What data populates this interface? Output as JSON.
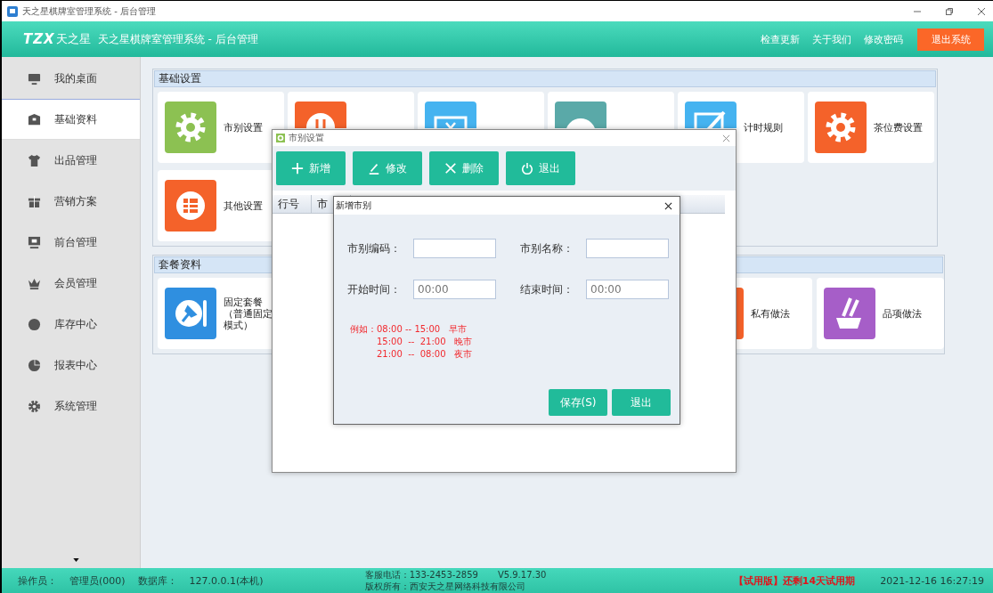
{
  "window": {
    "title": "天之星棋牌室管理系统 - 后台管理"
  },
  "header": {
    "logo_mark": "TZX",
    "logo_text": "天之星",
    "title": "天之星棋牌室管理系统 - 后台管理",
    "links": [
      "检查更新",
      "关于我们",
      "修改密码"
    ],
    "exit_button": "退出系统"
  },
  "sidebar": {
    "items": [
      {
        "label": "我的桌面",
        "selected": false
      },
      {
        "label": "基础资料",
        "selected": true
      },
      {
        "label": "出品管理",
        "selected": false
      },
      {
        "label": "营销方案",
        "selected": false
      },
      {
        "label": "前台管理",
        "selected": false
      },
      {
        "label": "会员管理",
        "selected": false
      },
      {
        "label": "库存中心",
        "selected": false
      },
      {
        "label": "报表中心",
        "selected": false
      },
      {
        "label": "系统管理",
        "selected": false
      }
    ]
  },
  "groups": [
    {
      "title": "基础设置",
      "tiles": [
        {
          "label": [
            "市别设置"
          ],
          "color": "#8cc152"
        },
        {
          "color": "#f4622a"
        },
        {
          "color": "#45b3f0"
        },
        {
          "color": "#5aa9a8"
        },
        {
          "label": [
            "计时规则"
          ],
          "color": "#45b3f0"
        },
        {
          "label": [
            "茶位费设置"
          ],
          "color": "#f4622a"
        },
        {
          "label": [
            "其他设置"
          ],
          "color": "#f4622a"
        }
      ]
    },
    {
      "title": "套餐资料",
      "tiles": [
        {
          "label": [
            "固定套餐",
            "（普通固定",
            "模式）"
          ],
          "color": "#2f8fe0"
        },
        {
          "label": [
            "私有做法"
          ],
          "color": "#f4622a"
        },
        {
          "label": [
            "品项做法"
          ],
          "color": "#a65ec8"
        }
      ]
    }
  ],
  "settings_dialog": {
    "title": "市别设置",
    "buttons": [
      "新增",
      "修改",
      "删除",
      "退出"
    ],
    "columns": [
      "行号",
      "市"
    ]
  },
  "add_dialog": {
    "title": "新增市别",
    "fields": [
      {
        "label": "市别编码："
      },
      {
        "label": "市别名称："
      },
      {
        "label": "开始时间：",
        "value": "00:00"
      },
      {
        "label": "结束时间：",
        "value": "00:00"
      }
    ],
    "example_lines": [
      "例如：08:00 -- 15:00   早市",
      "15:00  --  21:00   晚市",
      "21:00  --  08:00   夜市"
    ],
    "buttons": [
      "保存(S)",
      "退出"
    ]
  },
  "status_bar": {
    "operator_label": "操作员：",
    "operator": "管理员(000)",
    "db_label": "数据库：",
    "db": "127.0.0.1(本机)",
    "phone": "客服电话：133-2453-2859",
    "version": "V5.9.17.30",
    "copyright": "版权所有：西安天之星网络科技有限公司",
    "trial": "【试用版】还剩14天试用期",
    "datetime": "2021-12-16 16:27:19"
  }
}
